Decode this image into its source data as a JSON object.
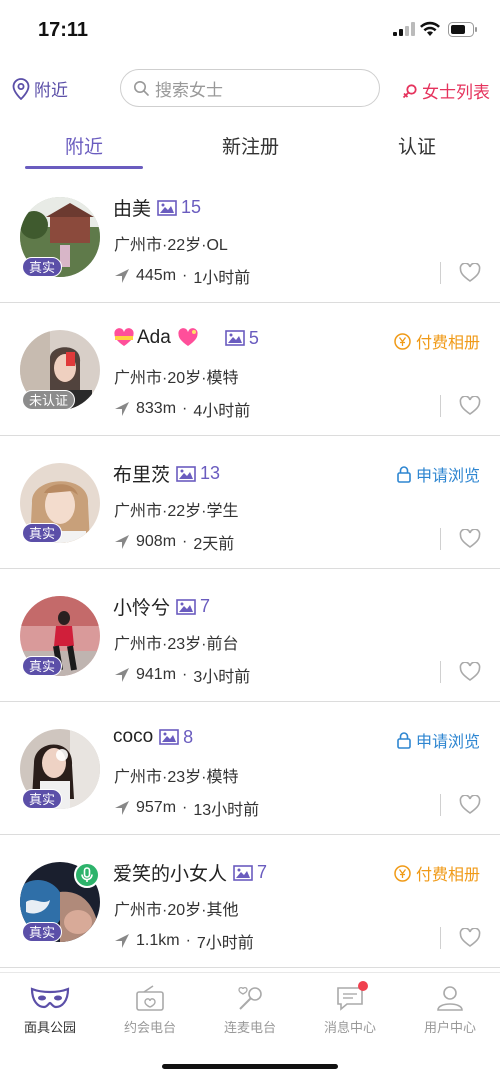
{
  "status_bar": {
    "time": "17:11"
  },
  "top_bar": {
    "nearby_label": "附近",
    "search_placeholder": "搜索女士",
    "lady_list_label": "女士列表"
  },
  "tabs": [
    {
      "label": "附近",
      "active": true
    },
    {
      "label": "新注册",
      "active": false
    },
    {
      "label": "认证",
      "active": false
    }
  ],
  "list": [
    {
      "name": "由美",
      "photo_count": "15",
      "info": "广州市·22岁·OL",
      "distance": "445m",
      "time": "1小时前",
      "badge": "真实",
      "action": ""
    },
    {
      "name": "Ada",
      "photo_count": "5",
      "info": "广州市·20岁·模特",
      "distance": "833m",
      "time": "4小时前",
      "badge": "未认证",
      "action": "付费相册"
    },
    {
      "name": "布里茨",
      "photo_count": "13",
      "info": "广州市·22岁·学生",
      "distance": "908m",
      "time": "2天前",
      "badge": "真实",
      "action": "申请浏览"
    },
    {
      "name": "小怜兮",
      "photo_count": "7",
      "info": "广州市·23岁·前台",
      "distance": "941m",
      "time": "3小时前",
      "badge": "真实",
      "action": ""
    },
    {
      "name": "coco",
      "photo_count": "8",
      "info": "广州市·23岁·模特",
      "distance": "957m",
      "time": "13小时前",
      "badge": "真实",
      "action": "申请浏览"
    },
    {
      "name": "爱笑的小女人",
      "photo_count": "7",
      "info": "广州市·20岁·其他",
      "distance": "1.1km",
      "time": "7小时前",
      "badge": "真实",
      "action": "付费相册"
    }
  ],
  "distance_separator": "·",
  "bottom_nav": [
    {
      "label": "面具公园",
      "icon": "mask-icon",
      "active": true
    },
    {
      "label": "约会电台",
      "icon": "radio-icon",
      "active": false
    },
    {
      "label": "连麦电台",
      "icon": "microphone-icon",
      "active": false
    },
    {
      "label": "消息中心",
      "icon": "message-icon",
      "active": false
    },
    {
      "label": "用户中心",
      "icon": "user-icon",
      "active": false
    }
  ],
  "colors": {
    "accent": "#6a5cbf",
    "paid": "#f09a17",
    "apply": "#2e86d1",
    "lady_list": "#e5335d",
    "real_badge": "#5b4fa8"
  }
}
